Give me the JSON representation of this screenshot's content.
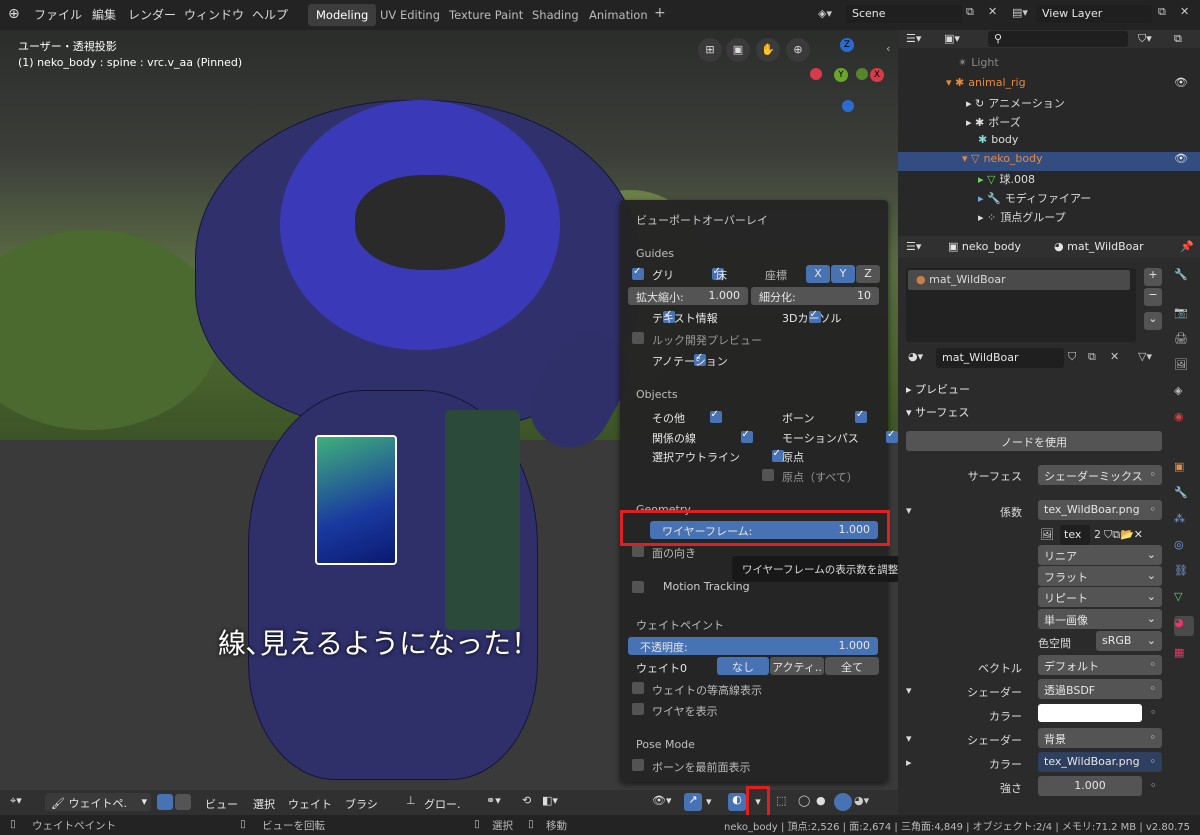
{
  "header": {
    "menus": [
      "ファイル",
      "編集",
      "レンダー",
      "ウィンドウ",
      "ヘルプ"
    ],
    "workspaces": [
      "Modeling",
      "UV Editing",
      "Texture Paint",
      "Shading",
      "Animation"
    ],
    "active_workspace": "Modeling",
    "add_tab": "+",
    "scene": "Scene",
    "view_layer": "View Layer"
  },
  "viewport": {
    "title": "ユーザー・透視投影",
    "subtitle": "(1) neko_body : spine : vrc.v_aa (Pinned)",
    "caption": "線､見えるようになった！",
    "gizmo": {
      "z": "Z",
      "y": "Y",
      "x": "X"
    }
  },
  "overlay": {
    "title": "ビューポートオーバーレイ",
    "guides": {
      "heading": "Guides",
      "grid": "グリ",
      "floor": "床",
      "axes_label": "座標",
      "axes": [
        "X",
        "Y",
        "Z"
      ],
      "scale_label": "拡大縮小:",
      "scale_value": "1.000",
      "subdiv_label": "細分化:",
      "subdiv_value": "10",
      "text_info": "テキスト情報",
      "cursor3d": "3Dカーソル",
      "lookdev": "ルック開発プレビュー",
      "annotation": "アノテーション"
    },
    "objects": {
      "heading": "Objects",
      "other": "その他",
      "bones": "ボーン",
      "relations": "関係の線",
      "motion_paths": "モーションパス",
      "outline": "選択アウトライン",
      "origins": "原点",
      "origins_all": "原点（すべて）"
    },
    "geometry": {
      "heading": "Geometry",
      "wireframe_label": "ワイヤーフレーム:",
      "wireframe_value": "1.000",
      "face_orient": "面の向き",
      "motion_tracking": "Motion Tracking"
    },
    "weight_paint": {
      "heading": "ウェイトペイント",
      "opacity_label": "不透明度:",
      "opacity_value": "1.000",
      "zero_label": "ウェイト0",
      "zero_options": [
        "なし",
        "アクティ..",
        "全て"
      ],
      "contours": "ウェイトの等高線表示",
      "wire": "ワイヤを表示"
    },
    "pose": {
      "heading": "Pose Mode",
      "bones_front": "ボーンを最前面表示"
    }
  },
  "tooltip": "ワイヤーフレームの表示数を調整します（1で全ワイヤー）.",
  "viewport_header": {
    "mode": "ウェイトペ.",
    "menus": [
      "ビュー",
      "選択",
      "ウェイト",
      "ブラシ"
    ],
    "transform": "グロー."
  },
  "outliner": {
    "rows": [
      "Light",
      "animal_rig",
      "アニメーション",
      "ポーズ",
      "body",
      "neko_body",
      "球.008",
      "モディファイアー",
      "頂点グループ"
    ]
  },
  "properties": {
    "object": "neko_body",
    "material": "mat_WildBoar",
    "slot": "mat_WildBoar",
    "mat_field": "mat_WildBoar",
    "preview": "プレビュー",
    "surface_section": "サーフェス",
    "use_nodes": "ノードを使用",
    "rows": [
      {
        "label": "サーフェス",
        "value": "シェーダーミックス"
      },
      {
        "label": "係数",
        "value": "tex_WildBoar.png"
      }
    ],
    "tex_name": "tex",
    "tex_users": "2",
    "dropdowns": [
      "リニア",
      "フラット",
      "リピート",
      "単一画像"
    ],
    "colorspace_label": "色空間",
    "colorspace": "sRGB",
    "vector_label": "ベクトル",
    "vector": "デフォルト",
    "shader1_label": "シェーダー",
    "shader1": "透過BSDF",
    "color_label": "カラー",
    "shader2_label": "シェーダー",
    "shader2": "背景",
    "color2_label": "カラー",
    "color2": "tex_WildBoar.png",
    "strength_label": "強さ",
    "strength": "1.000"
  },
  "status": {
    "left": "ウェイトペイント",
    "rotate": "ビューを回転",
    "select": "選択",
    "move": "移動",
    "stats": "neko_body | 頂点:2,526 | 面:2,674 | 三角面:4,849 | オブジェクト:2/4 | メモリ:71.2 MB | v2.80.75"
  }
}
